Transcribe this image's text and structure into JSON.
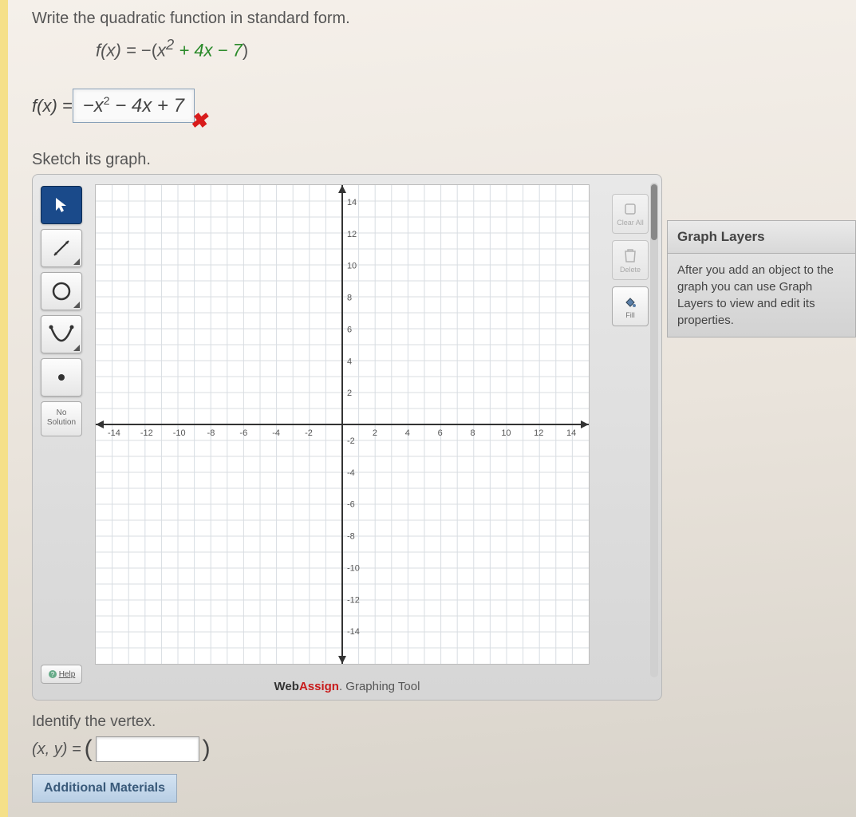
{
  "prompt": "Write the quadratic function in standard form.",
  "given_lhs": "f(x) = ",
  "given_rhs_pre": "−(",
  "given_rhs_x2": "x",
  "given_rhs_p1": " + ",
  "given_rhs_4x": "4x",
  "given_rhs_m7": " − 7",
  "given_rhs_close": ")",
  "answer_lhs": "f(x) = ",
  "answer_value": "−x² − 4x + 7",
  "answer_mark": "✖",
  "sketch_label": "Sketch its graph.",
  "tools": {
    "no_solution_l1": "No",
    "no_solution_l2": "Solution",
    "help": "Help",
    "fill": "Fill",
    "clear": "Clear All",
    "delete": "Delete"
  },
  "layers": {
    "title": "Graph Layers",
    "body": "After you add an object to the graph you can use Graph Layers to view and edit its properties."
  },
  "brand_web": "Web",
  "brand_assign": "Assign",
  "brand_suffix": ". Graphing Tool",
  "vertex_label": "Identify the vertex.",
  "vertex_lhs": "(x, y) = ",
  "additional": "Additional Materials",
  "chart_data": {
    "type": "scatter",
    "series": [],
    "title": "",
    "xlabel": "",
    "ylabel": "",
    "xlim": [
      -15,
      15
    ],
    "ylim": [
      -15,
      15
    ],
    "xticks": [
      -14,
      -12,
      -10,
      -8,
      -6,
      -4,
      -2,
      2,
      4,
      6,
      8,
      10,
      12,
      14
    ],
    "yticks": [
      -14,
      -12,
      -10,
      -8,
      -6,
      -4,
      -2,
      2,
      4,
      6,
      8,
      10,
      12,
      14
    ],
    "grid": true
  }
}
